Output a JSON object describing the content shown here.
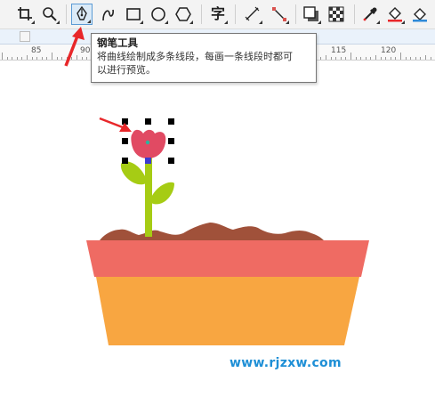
{
  "toolbar": {
    "tools": [
      {
        "id": "crop",
        "icon": "crop-icon"
      },
      {
        "id": "zoom",
        "icon": "zoom-icon"
      },
      {
        "id": "pen",
        "icon": "pen-nib-icon",
        "active": true
      },
      {
        "id": "bspline",
        "icon": "curve-icon"
      },
      {
        "id": "rectangle",
        "icon": "rectangle-icon"
      },
      {
        "id": "ellipse",
        "icon": "ellipse-icon"
      },
      {
        "id": "polygon",
        "icon": "polygon-icon"
      },
      {
        "id": "text",
        "icon": "text-icon",
        "label": "字"
      },
      {
        "id": "dimension",
        "icon": "dimension-line-icon"
      },
      {
        "id": "connector",
        "icon": "connector-icon"
      },
      {
        "id": "dropshadow",
        "icon": "drop-shadow-icon"
      },
      {
        "id": "transparency",
        "icon": "transparency-icon"
      },
      {
        "id": "eyedropper",
        "icon": "eyedropper-icon"
      },
      {
        "id": "fill",
        "icon": "fill-bucket-icon"
      },
      {
        "id": "smartfill",
        "icon": "smart-fill-icon"
      }
    ]
  },
  "ruler": {
    "labels": [
      "85",
      "90",
      "115",
      "120"
    ]
  },
  "tooltip": {
    "title": "钢笔工具",
    "description_line1": "将曲线绘制成多条线段，每画一条线段时都可",
    "description_line2": "以进行预览。"
  },
  "artwork": {
    "colors": {
      "pot_rim": "#ef6b63",
      "pot_body": "#f8a641",
      "soil": "#a0513a",
      "stem": "#a6cc14",
      "flower": "#e14a63",
      "selection_handle": "#000000",
      "arrow": "#e8272a"
    }
  },
  "watermark": "www.rjzxw.com"
}
